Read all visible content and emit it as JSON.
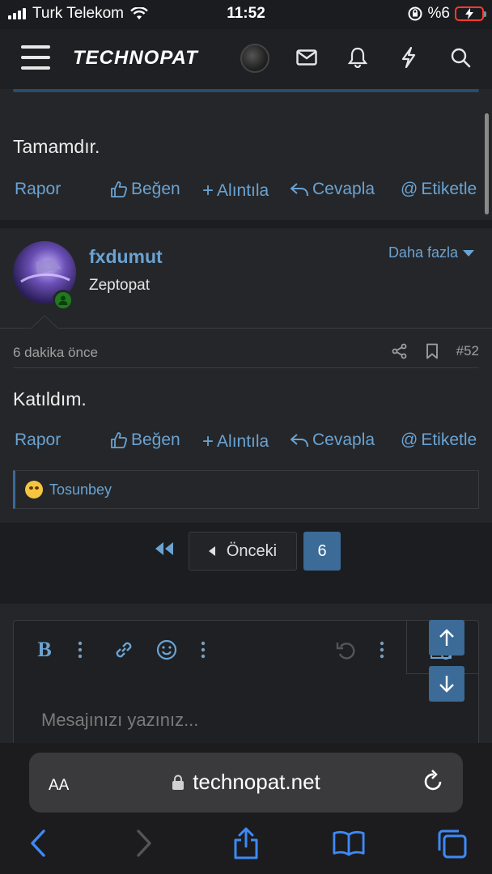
{
  "status_bar": {
    "carrier": "Turk Telekom",
    "time": "11:52",
    "battery": "%6"
  },
  "header": {
    "logo": "TECHNOPAT",
    "icons": [
      "menu-icon",
      "avatar",
      "mail-icon",
      "bell-icon",
      "bolt-icon",
      "search-icon"
    ]
  },
  "post1": {
    "text": "Tamamdır.",
    "actions": {
      "report": "Rapor",
      "like": "Beğen",
      "quote": "Alıntıla",
      "reply": "Cevapla",
      "mention": "Etiketle"
    }
  },
  "post2": {
    "username": "fxdumut",
    "user_title": "Zeptopat",
    "more": "Daha fazla",
    "time_ago": "6 dakika önce",
    "post_number": "#52",
    "text": "Katıldım.",
    "actions": {
      "report": "Rapor",
      "like": "Beğen",
      "quote": "Alıntıla",
      "reply": "Cevapla",
      "mention": "Etiketle"
    },
    "reaction_user": "Tosunbey"
  },
  "pagination": {
    "prev_label": "Önceki",
    "current_page": "6"
  },
  "editor": {
    "bold_label": "B",
    "placeholder": "Mesajınızı yazınız..."
  },
  "safari": {
    "aa_label": "AA",
    "url": "technopat.net"
  },
  "colors": {
    "accent": "#6aa3d3",
    "button": "#3b6b96",
    "background": "#252629"
  }
}
